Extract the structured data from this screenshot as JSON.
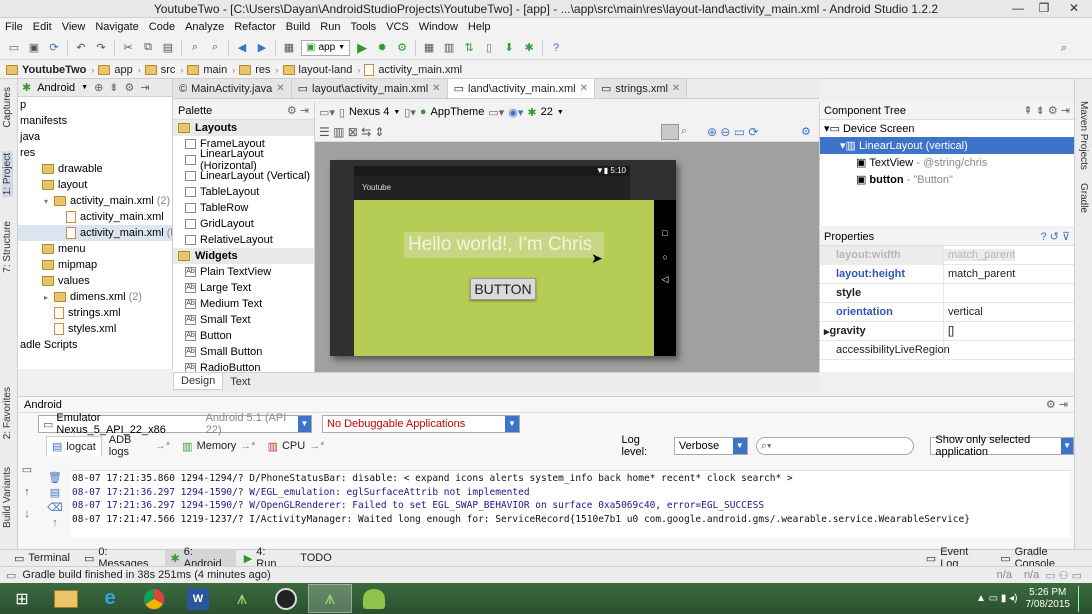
{
  "window": {
    "title": "YoutubeTwo - [C:\\Users\\Dayan\\AndroidStudioProjects\\YoutubeTwo] - [app] - ...\\app\\src\\main\\res\\layout-land\\activity_main.xml - Android Studio 1.2.2"
  },
  "menu": [
    "File",
    "Edit",
    "View",
    "Navigate",
    "Code",
    "Analyze",
    "Refactor",
    "Build",
    "Run",
    "Tools",
    "VCS",
    "Window",
    "Help"
  ],
  "toolbar": {
    "run_config": "app"
  },
  "breadcrumbs": [
    "YoutubeTwo",
    "app",
    "src",
    "main",
    "res",
    "layout-land",
    "activity_main.xml"
  ],
  "left_tools": [
    "1: Project",
    "7: Structure",
    "Captures",
    "2: Favorites",
    "Build Variants"
  ],
  "right_tools": [
    "Maven Projects",
    "Gradle"
  ],
  "project": {
    "view": "Android",
    "tree": [
      {
        "label": "p",
        "indent": 0,
        "kind": "none"
      },
      {
        "label": "manifests",
        "indent": 0,
        "kind": "none"
      },
      {
        "label": "java",
        "indent": 0,
        "kind": "none"
      },
      {
        "label": "res",
        "indent": 0,
        "kind": "none"
      },
      {
        "label": "drawable",
        "indent": 1,
        "kind": "folder"
      },
      {
        "label": "layout",
        "indent": 1,
        "kind": "folder"
      },
      {
        "label": "activity_main.xml",
        "extra": "(2)",
        "indent": 2,
        "kind": "folder",
        "tw": "▾"
      },
      {
        "label": "activity_main.xml",
        "indent": 3,
        "kind": "file"
      },
      {
        "label": "activity_main.xml",
        "extra": "(land)",
        "indent": 3,
        "kind": "file",
        "selected": true
      },
      {
        "label": "menu",
        "indent": 1,
        "kind": "folder"
      },
      {
        "label": "mipmap",
        "indent": 1,
        "kind": "folder"
      },
      {
        "label": "values",
        "indent": 1,
        "kind": "folder"
      },
      {
        "label": "dimens.xml",
        "extra": "(2)",
        "indent": 2,
        "kind": "folder",
        "tw": "▸"
      },
      {
        "label": "strings.xml",
        "indent": 2,
        "kind": "file"
      },
      {
        "label": "styles.xml",
        "indent": 2,
        "kind": "file"
      },
      {
        "label": "adle Scripts",
        "indent": 0,
        "kind": "none"
      }
    ]
  },
  "editor_tabs": [
    {
      "label": "MainActivity.java",
      "active": false
    },
    {
      "label": "layout\\activity_main.xml",
      "active": false
    },
    {
      "label": "land\\activity_main.xml",
      "active": true
    },
    {
      "label": "strings.xml",
      "active": false
    }
  ],
  "palette": {
    "title": "Palette",
    "groups": [
      {
        "name": "Layouts",
        "items": [
          "FrameLayout",
          "LinearLayout (Horizontal)",
          "LinearLayout (Vertical)",
          "TableLayout",
          "TableRow",
          "GridLayout",
          "RelativeLayout"
        ]
      },
      {
        "name": "Widgets",
        "items": [
          "Plain TextView",
          "Large Text",
          "Medium Text",
          "Small Text",
          "Button",
          "Small Button",
          "RadioButton"
        ]
      }
    ]
  },
  "design_toolbar": {
    "device": "Nexus 4",
    "theme": "AppTheme",
    "api": "22"
  },
  "device_preview": {
    "status_time": "5:10",
    "app_title": "Youtube",
    "text_view": "Hello world!, I'm Chris",
    "button": "BUTTON",
    "content_color": "#b5cc55"
  },
  "editor_mode_tabs": [
    "Design",
    "Text"
  ],
  "component_tree": {
    "title": "Component Tree",
    "items": [
      {
        "label": "Device Screen",
        "indent": 0
      },
      {
        "label": "LinearLayout (vertical)",
        "indent": 1,
        "selected": true
      },
      {
        "label": "TextView",
        "extra": "- @string/chris",
        "indent": 2
      },
      {
        "label": "button",
        "extra": "- \"Button\"",
        "indent": 2
      }
    ]
  },
  "properties": {
    "title": "Properties",
    "rows": [
      {
        "key": "layout:width",
        "value": "match_parent",
        "style": "dim"
      },
      {
        "key": "layout:height",
        "value": "match_parent",
        "style": "link"
      },
      {
        "key": "style",
        "value": "",
        "style": ""
      },
      {
        "key": "orientation",
        "value": "vertical",
        "style": "link"
      },
      {
        "key": "gravity",
        "value": "[]",
        "style": ""
      },
      {
        "key": "accessibilityLiveRegion",
        "value": "",
        "style": "plain"
      }
    ]
  },
  "android_panel": {
    "title": "Android",
    "device": "Emulator Nexus_5_API_22_x86",
    "device_suffix": "Android 5.1 (API 22)",
    "app": "No Debuggable Applications",
    "tabs": [
      "logcat",
      "ADB logs",
      "Memory",
      "CPU"
    ],
    "log_level_label": "Log level:",
    "log_level": "Verbose",
    "search_placeholder": "",
    "filter": "Show only selected application",
    "logs": [
      "08-07 17:21:35.860    1294-1294/? D/PhoneStatusBar:  disable: < expand icons alerts system_info back home* recent* clock search* >",
      "08-07 17:21:36.297    1294-1590/? W/EGL_emulation:  eglSurfaceAttrib not implemented",
      "08-07 17:21:36.297    1294-1590/? W/OpenGLRenderer:  Failed to set EGL_SWAP_BEHAVIOR on surface 0xa5069c40, error=EGL_SUCCESS",
      "08-07 17:21:47.566    1219-1237/? I/ActivityManager:  Waited long enough for: ServiceRecord{1510e7b1 u0 com.google.android.gms/.wearable.service.WearableService}"
    ]
  },
  "bottom_tabs": [
    "Terminal",
    "0: Messages",
    "6: Android",
    "4: Run",
    "TODO"
  ],
  "bottom_right_tabs": [
    "Event Log",
    "Gradle Console"
  ],
  "status": {
    "message": "Gradle build finished in 38s 251ms (4 minutes ago)",
    "na1": "n/a",
    "na2": "n/a"
  },
  "taskbar": {
    "time": "5:26 PM",
    "date": "7/08/2015"
  }
}
